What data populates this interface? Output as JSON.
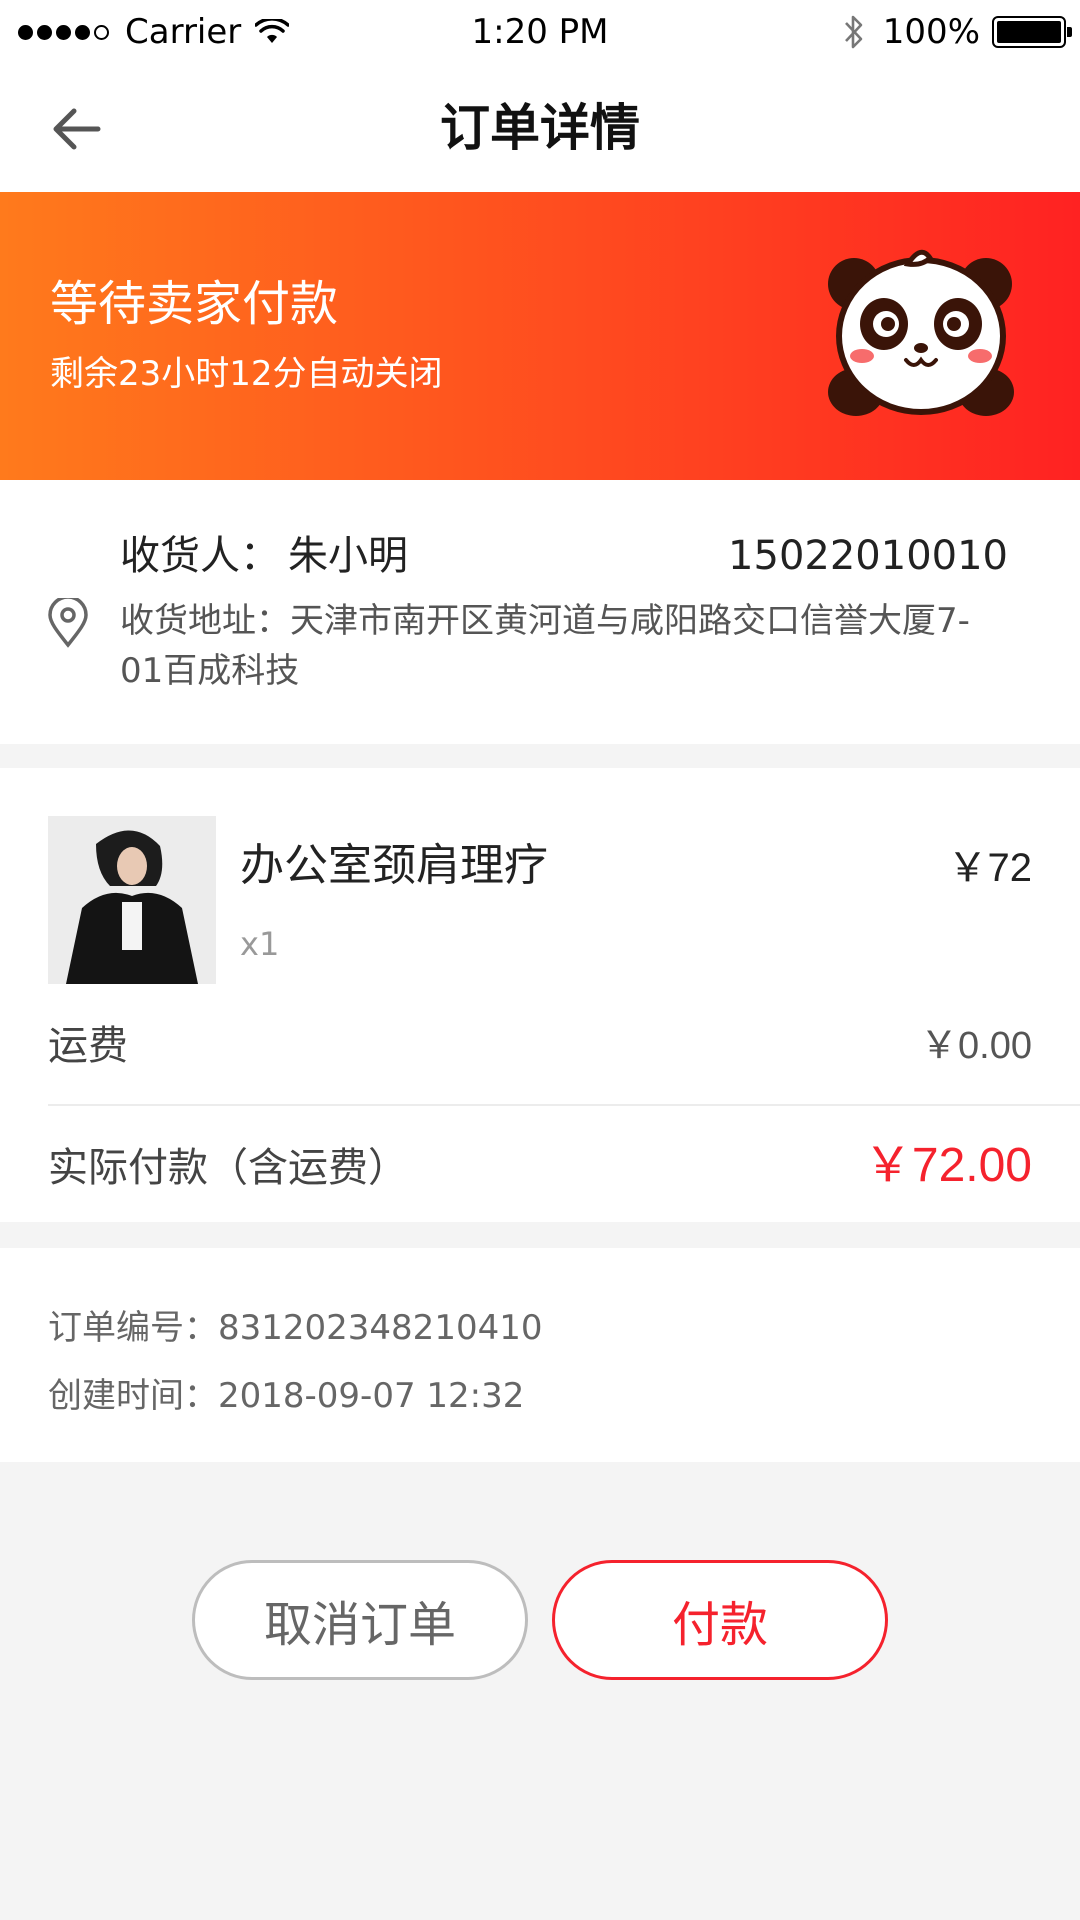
{
  "status_bar": {
    "carrier": "Carrier",
    "time": "1:20 PM",
    "battery": "100%"
  },
  "nav": {
    "title": "订单详情",
    "back_icon": "arrow-left-icon"
  },
  "banner": {
    "title": "等待卖家付款",
    "subtitle": "剩余23小时12分自动关闭",
    "mascot_icon": "panda-icon",
    "gradient_start": "#ff7a1c",
    "gradient_end": "#ff2222"
  },
  "address": {
    "receiver_label": "收货人：",
    "receiver_name": "朱小明",
    "phone": "15022010010",
    "address_text": "收货地址：天津市南开区黄河道与咸阳路交口信誉大厦7-01百成科技",
    "pin_icon": "location-pin-icon"
  },
  "goods": {
    "name": "办公室颈肩理疗",
    "price": "￥72",
    "quantity": "x1",
    "shipping_label": "运费",
    "shipping_value": "￥0.00",
    "total_label": "实际付款（含运费）",
    "total_value": "￥72.00"
  },
  "order_info": {
    "number_line": "订单编号：831202348210410",
    "created_line": "创建时间：2018-09-07 12:32"
  },
  "actions": {
    "cancel_label": "取消订单",
    "pay_label": "付款"
  },
  "colors": {
    "accent": "#f5222d",
    "background": "#f4f4f4"
  }
}
